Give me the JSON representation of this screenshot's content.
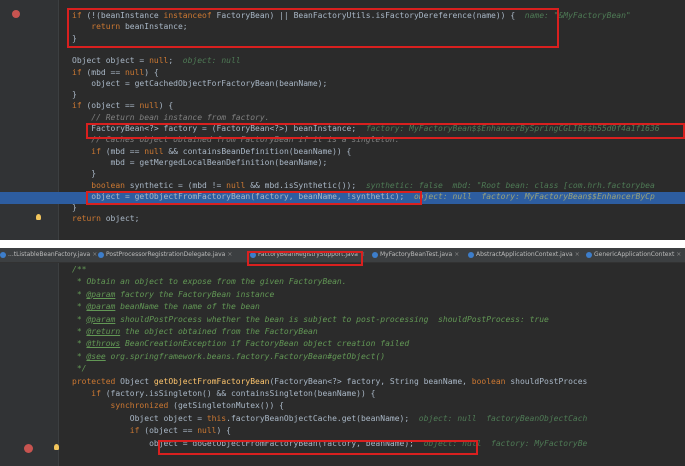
{
  "top": {
    "lines": [
      {
        "parts": [
          {
            "c": "kw",
            "t": "if "
          },
          {
            "c": "pl",
            "t": "(!(beanInstance "
          },
          {
            "c": "kw",
            "t": "instanceof "
          },
          {
            "c": "pl",
            "t": "FactoryBean) || BeanFactoryUtils."
          },
          {
            "c": "pl",
            "t": "isFactoryDereference(name)) {  "
          },
          {
            "c": "hint",
            "t": "name: \"&MyFactoryBean\""
          }
        ]
      },
      {
        "parts": [
          {
            "c": "kw",
            "t": "    return "
          },
          {
            "c": "pl",
            "t": "beanInstance;"
          }
        ]
      },
      {
        "parts": [
          {
            "c": "pl",
            "t": "}"
          }
        ]
      },
      {
        "parts": []
      },
      {
        "parts": [
          {
            "c": "pl",
            "t": "Object object = "
          },
          {
            "c": "kw",
            "t": "null"
          },
          {
            "c": "pl",
            "t": ";  "
          },
          {
            "c": "hint",
            "t": "object: null"
          }
        ]
      },
      {
        "parts": [
          {
            "c": "kw",
            "t": "if "
          },
          {
            "c": "pl",
            "t": "(mbd == "
          },
          {
            "c": "kw",
            "t": "null"
          },
          {
            "c": "pl",
            "t": ") {"
          }
        ]
      },
      {
        "parts": [
          {
            "c": "pl",
            "t": "    object = getCachedObjectForFactoryBean(beanName);"
          }
        ]
      },
      {
        "parts": [
          {
            "c": "pl",
            "t": "}"
          }
        ]
      },
      {
        "parts": [
          {
            "c": "kw",
            "t": "if "
          },
          {
            "c": "pl",
            "t": "(object == "
          },
          {
            "c": "kw",
            "t": "null"
          },
          {
            "c": "pl",
            "t": ") {"
          }
        ]
      },
      {
        "parts": [
          {
            "c": "cm",
            "t": "    // Return bean instance from factory."
          }
        ]
      },
      {
        "parts": [
          {
            "c": "pl",
            "t": "    FactoryBean<?> factory = (FactoryBean<?>) beanInstance;  "
          },
          {
            "c": "hint",
            "t": "factory: MyFactoryBean$$EnhancerBySpringCGLIB$$b55d0f4a1f1636"
          }
        ]
      },
      {
        "parts": [
          {
            "c": "cm",
            "t": "    // Caches object obtained from FactoryBean if it is a singleton."
          }
        ]
      },
      {
        "parts": [
          {
            "c": "kw",
            "t": "    if "
          },
          {
            "c": "pl",
            "t": "(mbd == "
          },
          {
            "c": "kw",
            "t": "null "
          },
          {
            "c": "pl",
            "t": "&& containsBeanDefinition(beanName)) {"
          }
        ]
      },
      {
        "parts": [
          {
            "c": "pl",
            "t": "        mbd = getMergedLocalBeanDefinition(beanName);"
          }
        ]
      },
      {
        "parts": [
          {
            "c": "pl",
            "t": "    }"
          }
        ]
      },
      {
        "parts": [
          {
            "c": "kw",
            "t": "    boolean "
          },
          {
            "c": "pl",
            "t": "synthetic = (mbd != "
          },
          {
            "c": "kw",
            "t": "null "
          },
          {
            "c": "pl",
            "t": "&& mbd.isSynthetic());  "
          },
          {
            "c": "hint",
            "t": "synthetic: false  mbd: \"Root bean: class [com.hrh.factorybea"
          }
        ]
      },
      {
        "parts": [
          {
            "c": "pl",
            "t": "    object = getObjectFromFactoryBean(factory, beanName, !synthetic);  "
          },
          {
            "c": "hintb",
            "t": "object: null  factory: MyFactoryBean$$EnhancerByCp"
          }
        ]
      },
      {
        "parts": [
          {
            "c": "pl",
            "t": "}"
          }
        ]
      },
      {
        "parts": [
          {
            "c": "kw",
            "t": "return "
          },
          {
            "c": "pl",
            "t": "object;"
          }
        ]
      }
    ]
  },
  "bottom": {
    "tabs": [
      {
        "label": "...tListableBeanFactory.java"
      },
      {
        "label": "PostProcessorRegistrationDelegate.java"
      },
      {
        "label": "FactoryBeanRegistrySupport.java"
      },
      {
        "label": "MyFactoryBeanTest.java"
      },
      {
        "label": "AbstractApplicationContext.java"
      },
      {
        "label": "GenericApplicationContext"
      }
    ],
    "lines": [
      {
        "parts": [
          {
            "c": "dc",
            "t": "/**"
          }
        ]
      },
      {
        "parts": [
          {
            "c": "dc",
            "t": " * Obtain an object to expose from the given FactoryBean."
          }
        ]
      },
      {
        "parts": [
          {
            "c": "dc",
            "t": " * "
          },
          {
            "c": "tg",
            "t": "@param"
          },
          {
            "c": "dc",
            "t": " factory the FactoryBean instance"
          }
        ]
      },
      {
        "parts": [
          {
            "c": "dc",
            "t": " * "
          },
          {
            "c": "tg",
            "t": "@param"
          },
          {
            "c": "dc",
            "t": " beanName the name of the bean"
          }
        ]
      },
      {
        "parts": [
          {
            "c": "dc",
            "t": " * "
          },
          {
            "c": "tg",
            "t": "@param"
          },
          {
            "c": "dc",
            "t": " shouldPostProcess whether the bean is subject to post-processing  shouldPostProcess: true"
          }
        ]
      },
      {
        "parts": [
          {
            "c": "dc",
            "t": " * "
          },
          {
            "c": "tg",
            "t": "@return"
          },
          {
            "c": "dc",
            "t": " the object obtained from the FactoryBean"
          }
        ]
      },
      {
        "parts": [
          {
            "c": "dc",
            "t": " * "
          },
          {
            "c": "tg",
            "t": "@throws"
          },
          {
            "c": "dc",
            "t": " BeanCreationException if FactoryBean object creation failed"
          }
        ]
      },
      {
        "parts": [
          {
            "c": "dc",
            "t": " * "
          },
          {
            "c": "tg",
            "t": "@see"
          },
          {
            "c": "dc",
            "t": " org.springframework.beans.factory.FactoryBean#getObject()"
          }
        ]
      },
      {
        "parts": [
          {
            "c": "dc",
            "t": " */"
          }
        ]
      },
      {
        "parts": [
          {
            "c": "kw",
            "t": "protected "
          },
          {
            "c": "pl",
            "t": "Object "
          },
          {
            "c": "fn",
            "t": "getObjectFromFactoryBean"
          },
          {
            "c": "pl",
            "t": "(FactoryBean<?> factory, String beanName, "
          },
          {
            "c": "kw",
            "t": "boolean "
          },
          {
            "c": "pl",
            "t": "shouldPostProces"
          }
        ]
      },
      {
        "parts": [
          {
            "c": "kw",
            "t": "    if "
          },
          {
            "c": "pl",
            "t": "(factory.isSingleton() && containsSingleton(beanName)) {"
          }
        ]
      },
      {
        "parts": [
          {
            "c": "kw",
            "t": "        synchronized "
          },
          {
            "c": "pl",
            "t": "(getSingletonMutex()) {"
          }
        ]
      },
      {
        "parts": [
          {
            "c": "pl",
            "t": "            Object object = "
          },
          {
            "c": "kw",
            "t": "this"
          },
          {
            "c": "pl",
            "t": ".factoryBeanObjectCache.get(beanName);  "
          },
          {
            "c": "hint",
            "t": "object: null  factoryBeanObjectCach"
          }
        ]
      },
      {
        "parts": [
          {
            "c": "kw",
            "t": "            if "
          },
          {
            "c": "pl",
            "t": "(object == "
          },
          {
            "c": "kw",
            "t": "null"
          },
          {
            "c": "pl",
            "t": ") {"
          }
        ]
      },
      {
        "parts": [
          {
            "c": "pl",
            "t": "                object = doGetObjectFromFactoryBean(factory, beanName);  "
          },
          {
            "c": "hint",
            "t": "object: null  factory: MyFactoryBe"
          }
        ]
      }
    ]
  }
}
